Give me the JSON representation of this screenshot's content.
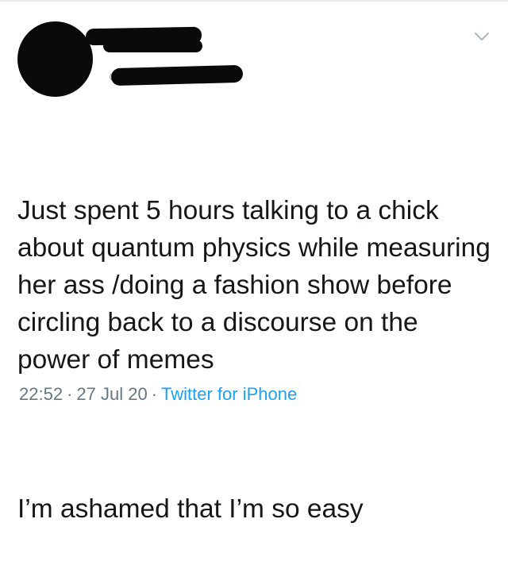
{
  "tweet": {
    "body_line_1": "Just spent 5 hours talking to a chick about quantum physics while measuring her ass /doing a fashion show before circling back to a discourse on the power of memes",
    "body_line_2": "I’m ashamed that I’m so easy",
    "time": "22:52",
    "date": "27 Jul 20",
    "separator": "·",
    "source": "Twitter for iPhone"
  },
  "icons": {
    "menu": "chevron-down-icon",
    "avatar": "avatar-redacted"
  },
  "colors": {
    "text": "#14171a",
    "meta": "#657786",
    "link": "#1da1f2",
    "redaction": "#0a0a0a"
  }
}
